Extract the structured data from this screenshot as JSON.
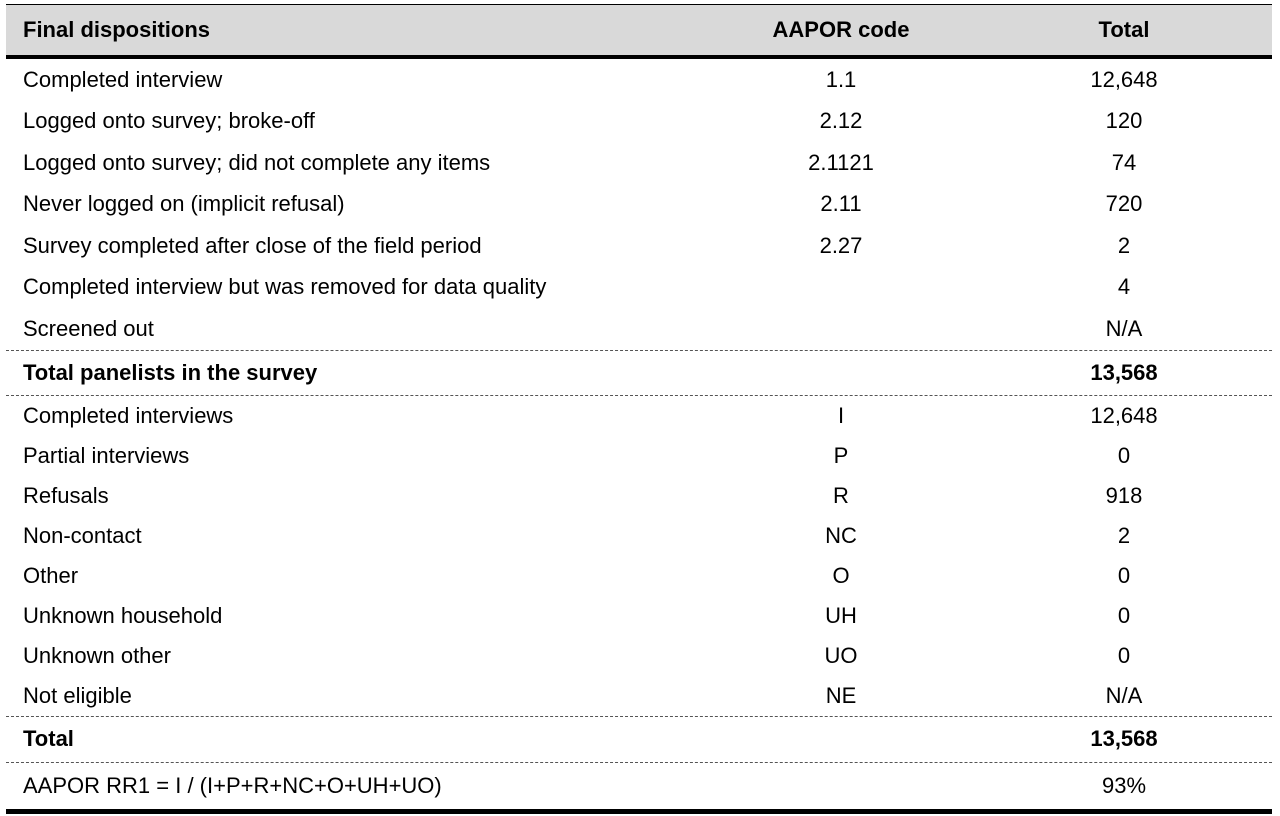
{
  "table": {
    "headers": [
      "Final dispositions",
      "AAPOR code",
      "Total"
    ],
    "section1": [
      {
        "label": "Completed interview",
        "code": "1.1",
        "total": "12,648"
      },
      {
        "label": "Logged onto survey; broke-off",
        "code": "2.12",
        "total": "120"
      },
      {
        "label": "Logged onto survey; did not complete any items",
        "code": "2.1121",
        "total": "74"
      },
      {
        "label": "Never logged on (implicit refusal)",
        "code": "2.11",
        "total": "720"
      },
      {
        "label": "Survey completed after close of the field period",
        "code": "2.27",
        "total": "2"
      },
      {
        "label": "Completed interview but was removed for data quality",
        "code": "",
        "total": "4"
      },
      {
        "label": "Screened out",
        "code": "",
        "total": "N/A"
      }
    ],
    "subtotal": {
      "label": "Total panelists in the survey",
      "total": "13,568"
    },
    "section2": [
      {
        "label": "Completed interviews",
        "code": "I",
        "total": "12,648"
      },
      {
        "label": "Partial interviews",
        "code": "P",
        "total": "0"
      },
      {
        "label": "Refusals",
        "code": "R",
        "total": "918"
      },
      {
        "label": "Non-contact",
        "code": "NC",
        "total": "2"
      },
      {
        "label": "Other",
        "code": "O",
        "total": "0"
      },
      {
        "label": "Unknown household",
        "code": "UH",
        "total": "0"
      },
      {
        "label": "Unknown other",
        "code": "UO",
        "total": "0"
      },
      {
        "label": "Not eligible",
        "code": "NE",
        "total": "N/A"
      }
    ],
    "grand_total": {
      "label": "Total",
      "total": "13,568"
    },
    "response_rate": {
      "label": "AAPOR RR1 = I / (I+P+R+NC+O+UH+UO)",
      "total": "93%"
    }
  }
}
